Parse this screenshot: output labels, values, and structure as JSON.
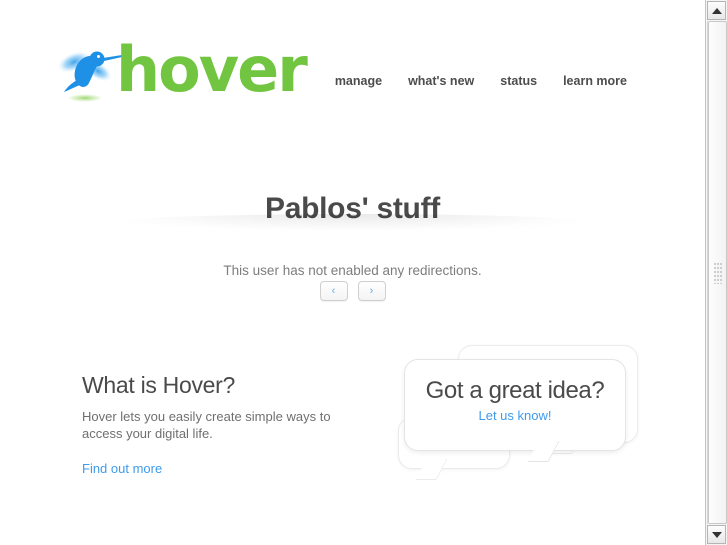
{
  "brand": {
    "wordmark": "hover",
    "bird_icon": "hummingbird-icon",
    "green": "#72c540",
    "blue": "#2196e8"
  },
  "nav": {
    "items": [
      {
        "label": "manage"
      },
      {
        "label": "what's new"
      },
      {
        "label": "status"
      },
      {
        "label": "learn more"
      }
    ]
  },
  "page": {
    "title": "Pablos' stuff",
    "empty_message": "This user has not enabled any redirections."
  },
  "pager": {
    "prev_label": "‹",
    "next_label": "›",
    "accent": "#5fa9e8"
  },
  "promo": {
    "heading": "What is Hover?",
    "body": "Hover lets you easily create simple ways to access your digital life.",
    "link_label": "Find out more",
    "link_color": "#3e9bec"
  },
  "bubble": {
    "heading": "Got a great idea?",
    "link_label": "Let us know!",
    "link_color": "#3e9bec"
  },
  "scrollbar": {
    "up_icon": "triangle-up-icon",
    "down_icon": "triangle-down-icon",
    "grip_icon": "grip-dots-icon"
  }
}
